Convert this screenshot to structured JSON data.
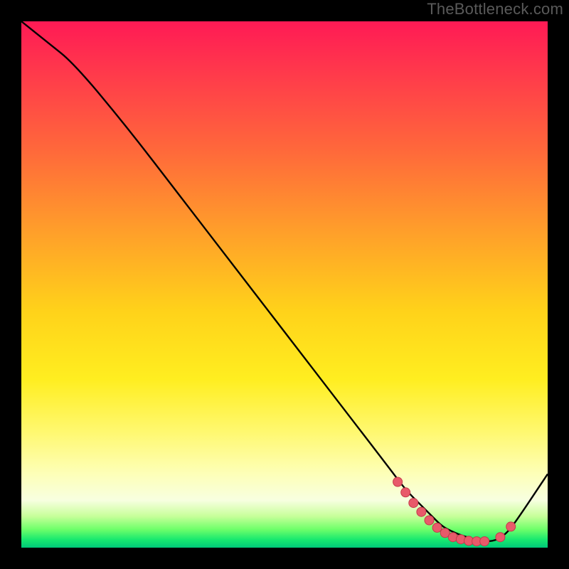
{
  "watermark": "TheBottleneck.com",
  "chart_data": {
    "type": "line",
    "title": "",
    "xlabel": "",
    "ylabel": "",
    "xlim": [
      0,
      100
    ],
    "ylim": [
      0,
      100
    ],
    "series": [
      {
        "name": "curve",
        "x": [
          0,
          5,
          10,
          20,
          30,
          40,
          50,
          60,
          70,
          73,
          76,
          78,
          80,
          82,
          84,
          86,
          88,
          90,
          92,
          94,
          100
        ],
        "y": [
          100,
          96,
          92,
          80,
          67,
          54,
          41,
          28,
          15,
          11,
          8,
          6,
          4,
          3,
          2.2,
          1.6,
          1.2,
          1.3,
          2.5,
          5,
          14
        ]
      }
    ],
    "markers": [
      {
        "x": 71.5,
        "y": 12.5
      },
      {
        "x": 73.0,
        "y": 10.5
      },
      {
        "x": 74.5,
        "y": 8.5
      },
      {
        "x": 76.0,
        "y": 6.8
      },
      {
        "x": 77.5,
        "y": 5.2
      },
      {
        "x": 79.0,
        "y": 3.8
      },
      {
        "x": 80.5,
        "y": 2.8
      },
      {
        "x": 82.0,
        "y": 2.0
      },
      {
        "x": 83.5,
        "y": 1.6
      },
      {
        "x": 85.0,
        "y": 1.3
      },
      {
        "x": 86.5,
        "y": 1.2
      },
      {
        "x": 88.0,
        "y": 1.2
      },
      {
        "x": 91.0,
        "y": 2.0
      },
      {
        "x": 93.0,
        "y": 4.0
      }
    ],
    "colors": {
      "line": "#000000",
      "marker_fill": "#e85a6a",
      "marker_stroke": "#c43a4a"
    }
  }
}
